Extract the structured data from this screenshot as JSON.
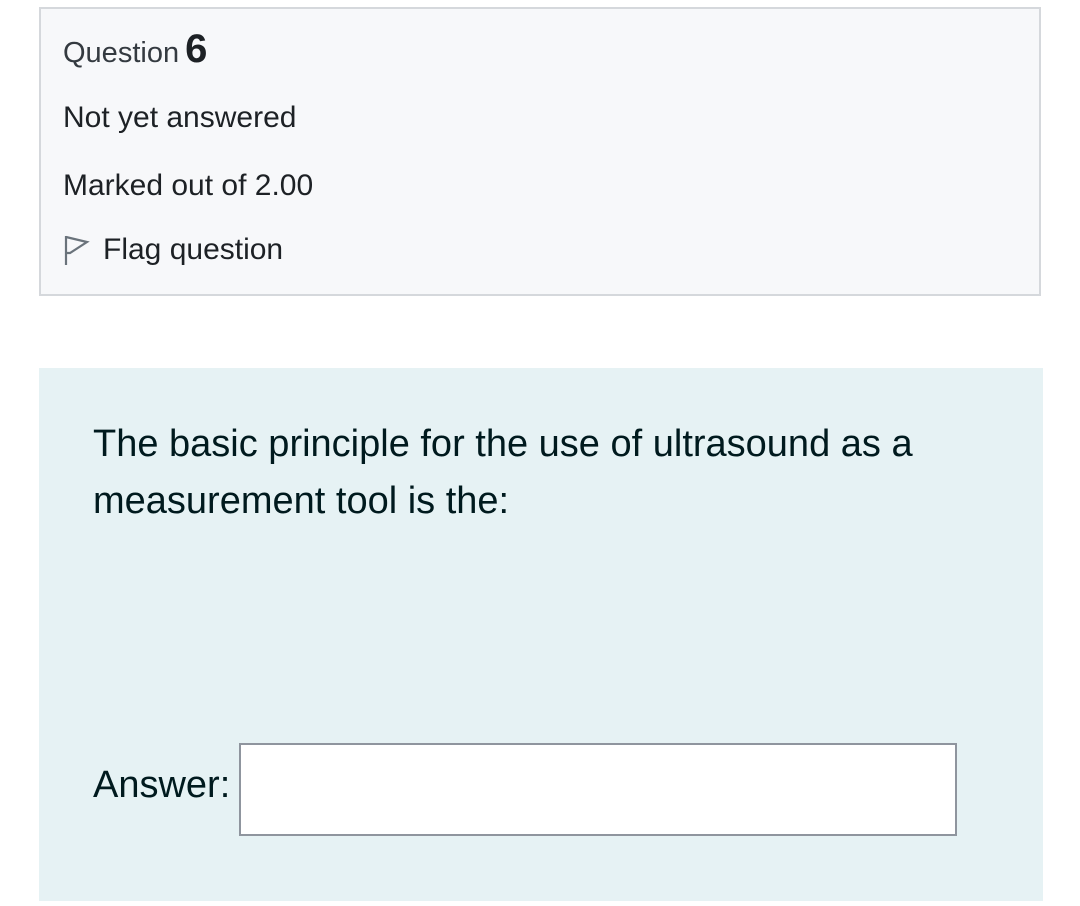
{
  "question_info": {
    "question_word": "Question",
    "question_number": "6",
    "status": "Not yet answered",
    "marks": "Marked out of 2.00",
    "flag_label": "Flag question",
    "flag_icon": "flag-outline-icon"
  },
  "question": {
    "text": "The basic principle for the use of ultrasound as a measurement tool is the:",
    "answer_label": "Answer:",
    "answer_value": "",
    "answer_placeholder": ""
  },
  "colors": {
    "info_background": "#f7f8fa",
    "info_border": "#d5d8dc",
    "question_background": "#e6f2f4",
    "text": "#1d2125",
    "input_border": "#8f959e"
  }
}
